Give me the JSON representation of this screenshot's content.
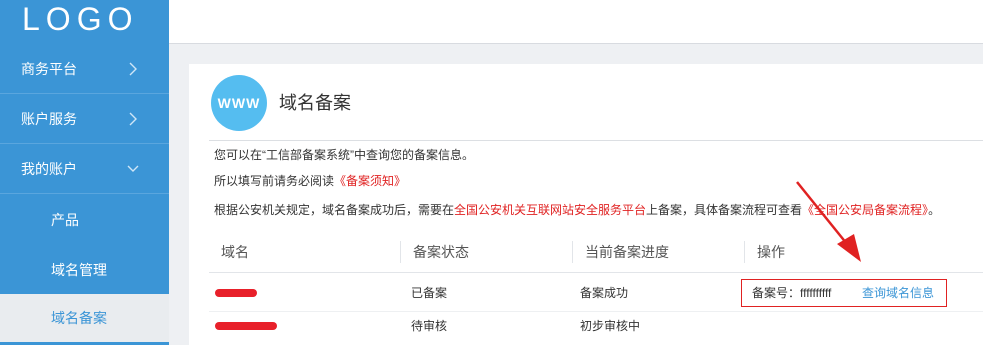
{
  "logo": "LOGO",
  "sidebar": {
    "items": [
      {
        "label": "商务平台"
      },
      {
        "label": "账户服务"
      },
      {
        "label": "我的账户"
      }
    ],
    "sub_items": [
      {
        "label": "产品"
      },
      {
        "label": "域名管理"
      },
      {
        "label": "域名备案"
      }
    ]
  },
  "card": {
    "icon_text": "WWW",
    "title": "域名备案",
    "line1": "您可以在“工信部备案系统”中查询您的备案信息。",
    "line2_prefix": "所以填写前请务必阅读",
    "line2_link": "《备案须知》",
    "line3_part1": "根据公安机关规定，域名备案成功后，需要在",
    "line3_link1": "全国公安机关互联网站安全服务平台",
    "line3_part2": "上备案，具体备案流程可查看",
    "line3_link2": "《全国公安局备案流程》",
    "line3_end": "。"
  },
  "table": {
    "headers": [
      "域名",
      "备案状态",
      "当前备案进度",
      "操作"
    ],
    "rows": [
      {
        "status": "已备案",
        "progress": "备案成功",
        "record_no": "备案号：ffffffffff",
        "action": "查询域名信息"
      },
      {
        "status": "待审核",
        "progress": "初步审核中"
      }
    ]
  },
  "colors": {
    "sidebar": "#3b95d6",
    "accent_red": "#e02222",
    "link_blue": "#3b95d6"
  }
}
